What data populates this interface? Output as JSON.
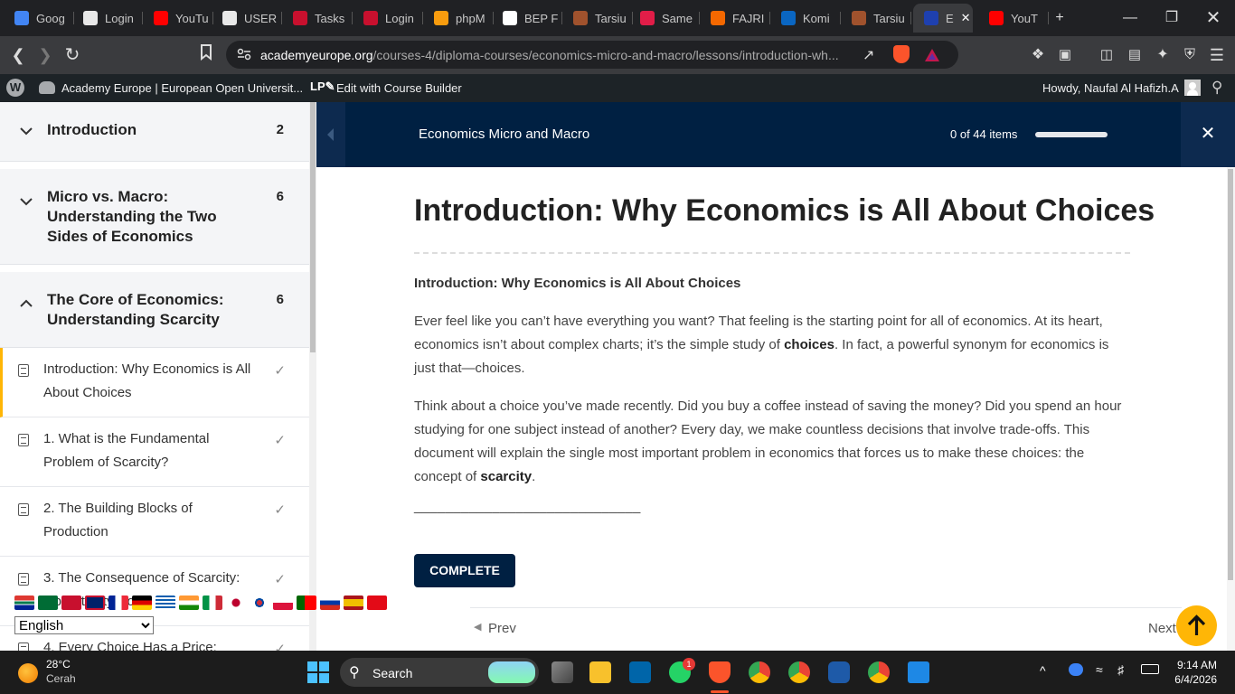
{
  "browser": {
    "tabs": [
      {
        "label": "Goog",
        "icon": "google-icon",
        "color": "#4285f4"
      },
      {
        "label": "Login",
        "icon": "login-icon",
        "color": "#e8e8e8"
      },
      {
        "label": "YouTu",
        "icon": "youtube-icon",
        "color": "#ff0000"
      },
      {
        "label": "USER",
        "icon": "page-icon",
        "color": "#e8e8e8"
      },
      {
        "label": "Tasks",
        "icon": "flag-uk-icon",
        "color": "#c8102e"
      },
      {
        "label": "Login",
        "icon": "flag-uk-icon",
        "color": "#c8102e"
      },
      {
        "label": "phpM",
        "icon": "phpmyadmin-icon",
        "color": "#f89c0e"
      },
      {
        "label": "BEP F",
        "icon": "openai-icon",
        "color": "#ffffff"
      },
      {
        "label": "Tarsiu",
        "icon": "tarsius-icon",
        "color": "#a0522d"
      },
      {
        "label": "Same",
        "icon": "same-icon",
        "color": "#e11d48"
      },
      {
        "label": "FAJRI",
        "icon": "grafana-icon",
        "color": "#f46800"
      },
      {
        "label": "Komi",
        "icon": "komi-icon",
        "color": "#0a66c2"
      },
      {
        "label": "Tarsiu",
        "icon": "tarsius-icon",
        "color": "#a0522d"
      },
      {
        "label": "E",
        "icon": "academy-icon",
        "color": "#1e40af"
      },
      {
        "label": "YouT",
        "icon": "youtube-icon",
        "color": "#ff0000"
      }
    ],
    "url_host": "academyeurope.org",
    "url_path": "/courses-4/diploma-courses/economics-micro-and-macro/lessons/introduction-wh..."
  },
  "wpbar": {
    "site_name": "Academy Europe | European Open Universit...",
    "edit_label": "Edit with Course Builder",
    "howdy": "Howdy, Naufal Al Hafizh.A"
  },
  "sidebar": {
    "sections": [
      {
        "title": "Introduction",
        "count": "2",
        "expanded": false
      },
      {
        "title": "Micro vs. Macro: Understanding the Two Sides of Economics",
        "count": "6",
        "expanded": false
      },
      {
        "title": "The Core of Economics: Understanding Scarcity",
        "count": "6",
        "expanded": true
      }
    ],
    "lessons": [
      {
        "title": "Introduction: Why Economics is All About Choices",
        "active": true
      },
      {
        "title": "1. What is the Fundamental Problem of Scarcity?",
        "active": false
      },
      {
        "title": "2. The Building Blocks of Production",
        "active": false
      },
      {
        "title": "3. The Consequence of Scarcity: Opportunity Cost",
        "active": false
      },
      {
        "title": "4. Every Choice Has a Price:",
        "active": false
      }
    ]
  },
  "course": {
    "title": "Economics Micro and Macro",
    "progress_text": "0 of 44 items",
    "progress_fraction": 0.0
  },
  "lesson": {
    "heading": "Introduction: Why Economics is All About Choices",
    "subheading": "Introduction: Why Economics is All About Choices",
    "p1_a": "Ever feel like you can’t have everything you want? That feeling is the starting point for all of economics. At its heart, economics isn’t about complex charts; it’s the simple study of ",
    "p1_bold": "choices",
    "p1_b": ". In fact, a powerful synonym for economics is just that—choices.",
    "p2_a": "Think about a choice you’ve made recently. Did you buy a coffee instead of saving the money? Did you spend an hour studying for one subject instead of another? Every day, we make countless decisions that involve trade-offs. This document will explain the single most important problem in economics that forces us to make these choices: the concept of ",
    "p2_bold": "scarcity",
    "p2_b": ".",
    "rule": "_____________________________",
    "complete_label": "COMPLETE",
    "prev_label": "Prev",
    "next_label": "Next"
  },
  "translator": {
    "language": "English",
    "options": [
      "English"
    ]
  },
  "taskbar": {
    "temp": "28°C",
    "weather": "Cerah",
    "search_label": "Search",
    "time": "9:14 AM",
    "date": "6/4/2026",
    "whatsapp_badge": "1"
  }
}
